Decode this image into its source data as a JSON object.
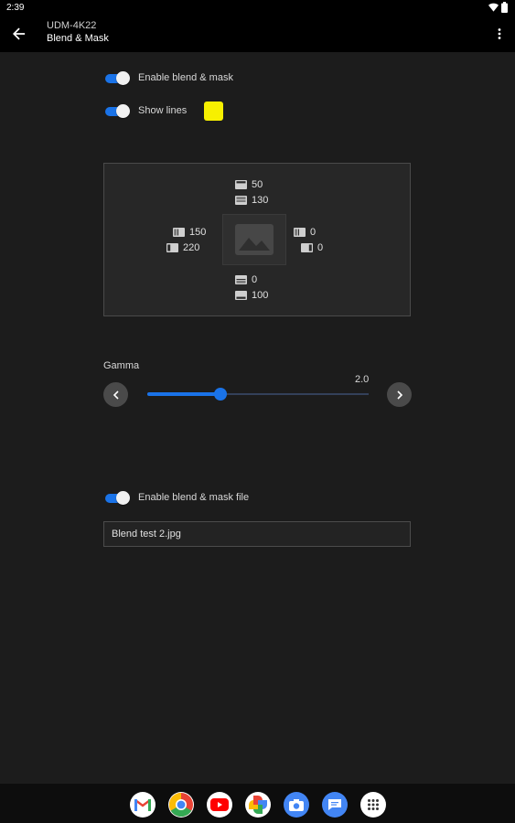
{
  "status_bar": {
    "time": "2:39"
  },
  "app_bar": {
    "subtitle": "UDM-4K22",
    "title": "Blend & Mask"
  },
  "toggles": {
    "enable_blend_mask": {
      "label": "Enable blend & mask",
      "on": true
    },
    "show_lines": {
      "label": "Show lines",
      "on": true,
      "color": "#f7f000"
    },
    "enable_blend_mask_file": {
      "label": "Enable blend & mask file",
      "on": true
    }
  },
  "blend_values": {
    "top_blend": "50",
    "top_mask": "130",
    "left_blend": "150",
    "left_mask": "220",
    "right_blend": "0",
    "right_mask": "0",
    "bottom_mask": "0",
    "bottom_blend": "100"
  },
  "gamma": {
    "label": "Gamma",
    "value": "2.0",
    "fraction": 0.33
  },
  "file_field": {
    "value": "Blend test 2.jpg"
  },
  "dock_apps": [
    "gmail",
    "chrome",
    "youtube",
    "photos",
    "camera",
    "messages",
    "app-drawer"
  ],
  "colors": {
    "accent": "#1a73e8",
    "background": "#1c1c1c"
  }
}
